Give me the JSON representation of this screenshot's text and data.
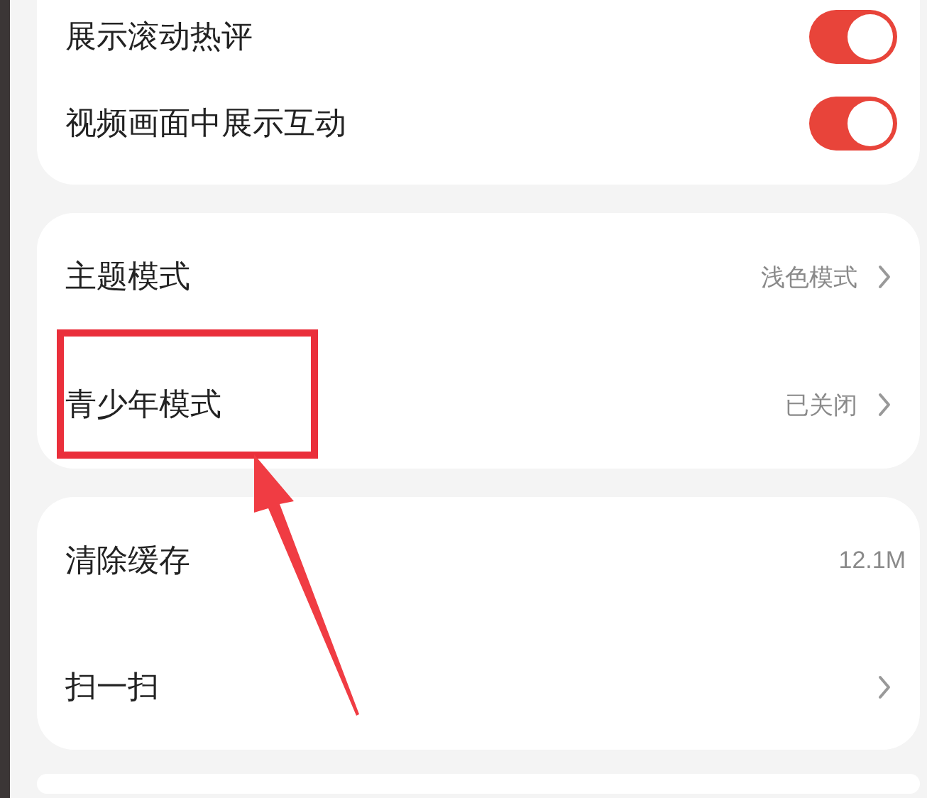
{
  "cards": [
    {
      "rows": [
        {
          "kind": "toggle",
          "label": "展示滚动热评",
          "on": true
        },
        {
          "kind": "toggle",
          "label": "视频画面中展示互动",
          "on": true
        }
      ]
    },
    {
      "rows": [
        {
          "kind": "link",
          "label": "主题模式",
          "value": "浅色模式",
          "highlighted": false
        },
        {
          "kind": "link",
          "label": "青少年模式",
          "value": "已关闭",
          "highlighted": true
        }
      ]
    },
    {
      "rows": [
        {
          "kind": "info",
          "label": "清除缓存",
          "value": "12.1M"
        },
        {
          "kind": "link",
          "label": "扫一扫"
        }
      ]
    }
  ]
}
